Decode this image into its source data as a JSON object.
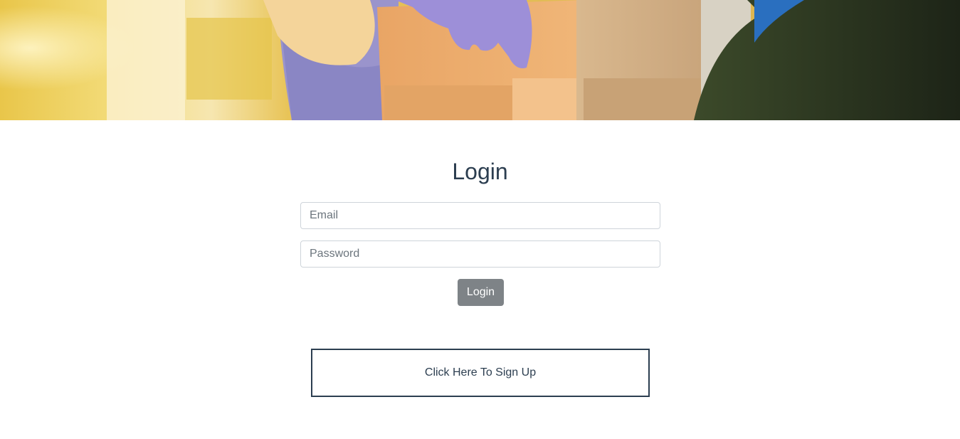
{
  "hero": {
    "image_name": "delivery-bag-hero-image"
  },
  "login": {
    "title": "Login",
    "email_placeholder": "Email",
    "email_value": "",
    "password_placeholder": "Password",
    "password_value": "",
    "button_label": "Login"
  },
  "signup": {
    "link_text": "Click Here To Sign Up"
  },
  "colors": {
    "text": "#2c3e50",
    "button_bg": "#7e8387",
    "input_border": "#ced4da"
  }
}
